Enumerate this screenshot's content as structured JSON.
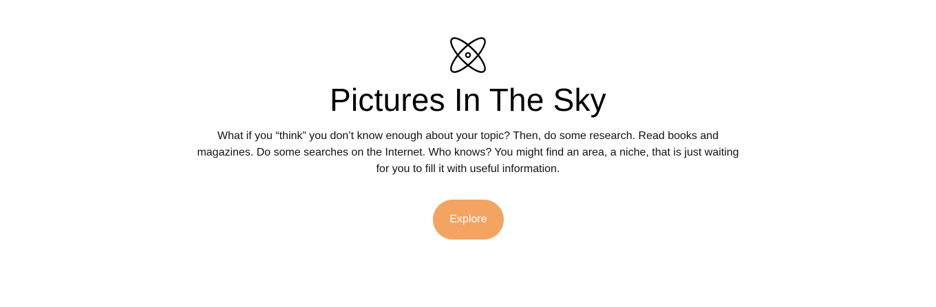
{
  "hero": {
    "icon": "atom-orbit-icon",
    "title": "Pictures In The Sky",
    "description": "What if you “think” you don’t know enough about your topic? Then, do some research. Read books and magazines. Do some searches on the Internet. Who knows? You might find an area, a niche, that is just waiting for you to fill it with useful information.",
    "button_label": "Explore"
  },
  "colors": {
    "background": "#ffffff",
    "text": "#111111",
    "button": "#f3a462",
    "button_text": "#ffffff"
  }
}
